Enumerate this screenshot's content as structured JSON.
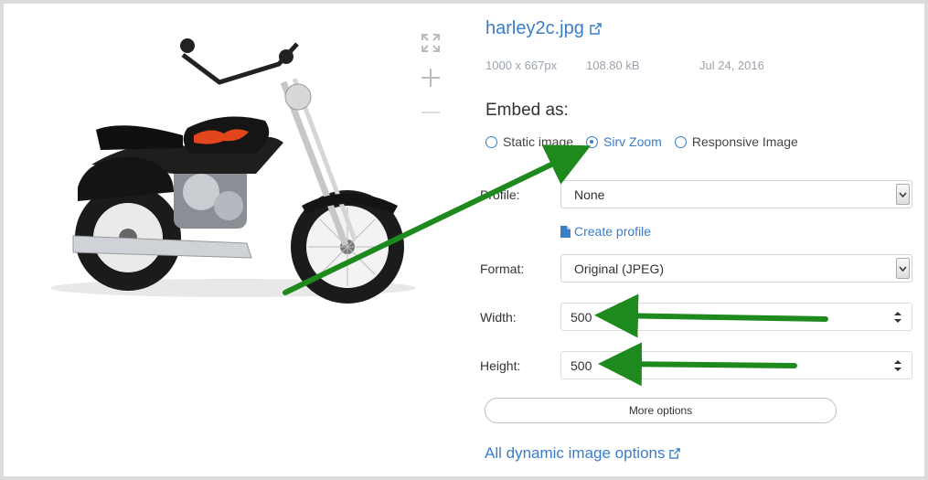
{
  "file": {
    "name": "harley2c.jpg",
    "dimensions": "1000 x 667px",
    "size": "108.80 kB",
    "date": "Jul 24, 2016"
  },
  "embed": {
    "label": "Embed as:",
    "options": [
      "Static image",
      "Sirv Zoom",
      "Responsive Image"
    ],
    "selected": "Sirv Zoom"
  },
  "form": {
    "profile_label": "Profile:",
    "profile_value": "None",
    "create_profile": "Create profile",
    "format_label": "Format:",
    "format_value": "Original (JPEG)",
    "width_label": "Width:",
    "width_value": "500",
    "height_label": "Height:",
    "height_value": "500"
  },
  "buttons": {
    "more_options": "More options"
  },
  "links": {
    "all_options": "All dynamic image options"
  },
  "colors": {
    "accent": "#3a7dc9",
    "annotation_arrow": "#1e8a1e"
  },
  "icons": [
    "fullscreen-icon",
    "zoom-in-icon",
    "zoom-out-icon",
    "external-link-icon",
    "file-icon",
    "radio-icon",
    "select-caret-icon",
    "spinner-icon"
  ]
}
